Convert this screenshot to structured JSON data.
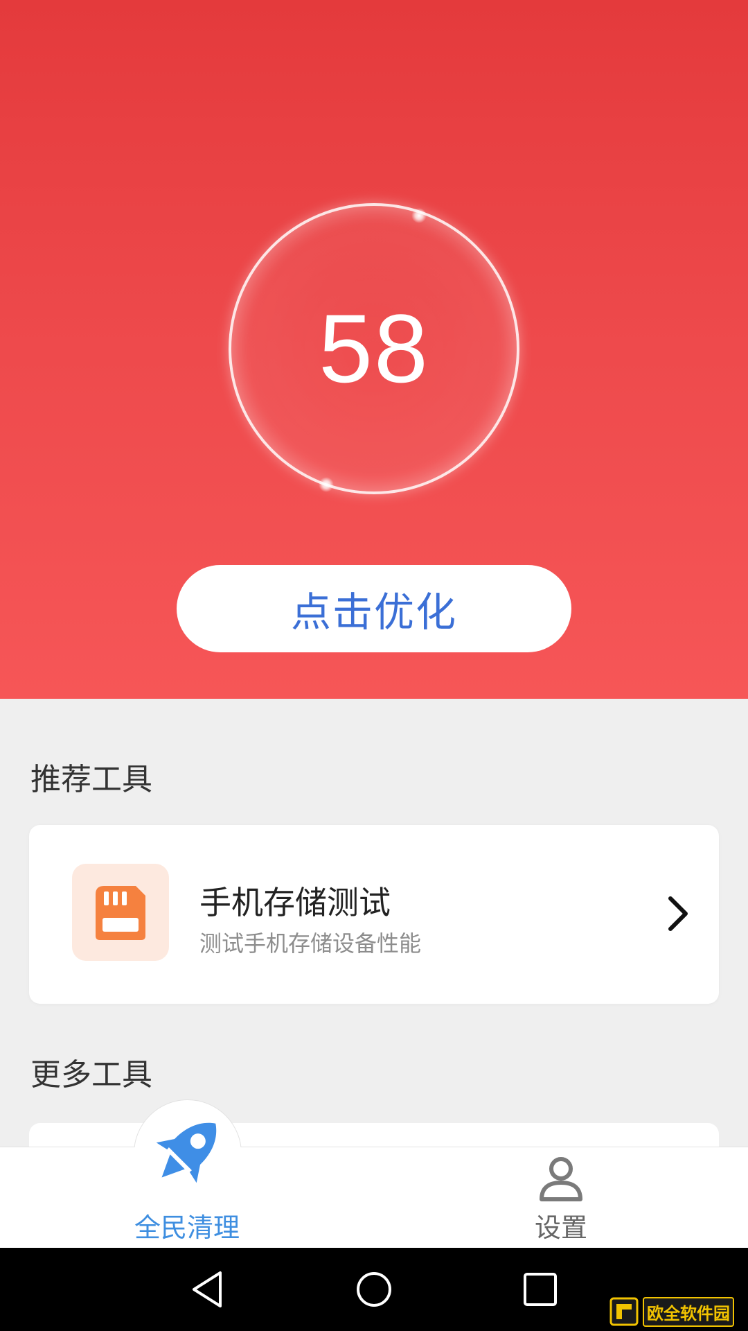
{
  "header": {
    "score": "58",
    "optimize_button": "点击优化"
  },
  "recommended": {
    "section_title": "推荐工具",
    "tool": {
      "icon": "sd-card-icon",
      "title": "手机存储测试",
      "subtitle": "测试手机存储设备性能"
    }
  },
  "more": {
    "section_title": "更多工具"
  },
  "tabbar": {
    "items": [
      {
        "label": "全民清理",
        "icon": "rocket-icon",
        "active": true
      },
      {
        "label": "设置",
        "icon": "user-icon",
        "active": false
      }
    ]
  },
  "watermark": {
    "text": "欧全软件园"
  },
  "colors": {
    "header_red": "#ee4a4c",
    "accent_blue": "#3b6fd6",
    "icon_orange": "#f5813f"
  }
}
